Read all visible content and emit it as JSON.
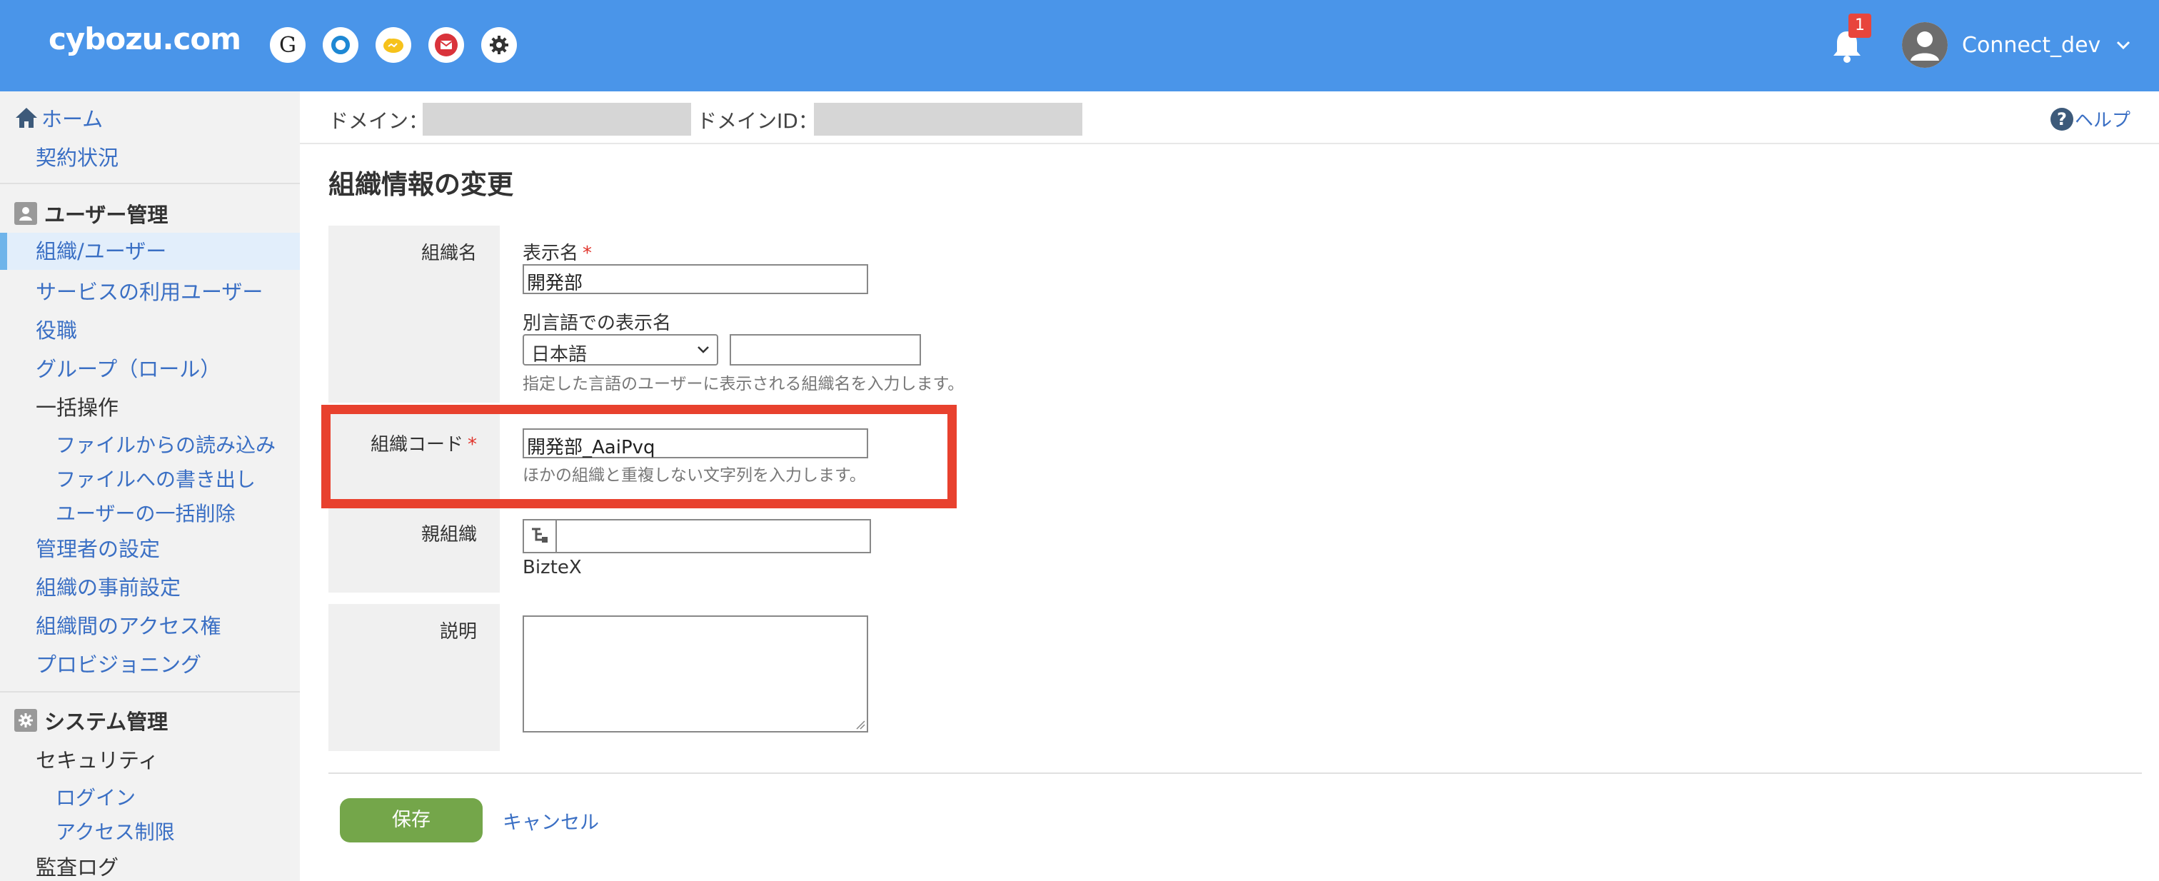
{
  "header": {
    "logo": "cybozu.com",
    "apps": [
      {
        "icon": "g-logo-icon",
        "glyph": "G"
      },
      {
        "icon": "garoon-ring-icon"
      },
      {
        "icon": "kintone-cloud-icon"
      },
      {
        "icon": "mail-icon"
      },
      {
        "icon": "gear-icon"
      }
    ],
    "notification_count": "1",
    "username": "Connect_dev"
  },
  "sidebar": {
    "home": "ホーム",
    "contract": "契約状況",
    "user_admin_heading": "ユーザー管理",
    "org_users": "組織/ユーザー",
    "service_users": "サービスの利用ユーザー",
    "roles": "役職",
    "groups": "グループ（ロール）",
    "bulk": "一括操作",
    "import_file": "ファイルからの読み込み",
    "export_file": "ファイルへの書き出し",
    "bulk_delete": "ユーザーの一括削除",
    "admin_settings": "管理者の設定",
    "org_presets": "組織の事前設定",
    "inter_org_access": "組織間のアクセス権",
    "provisioning": "プロビジョニング",
    "system_admin_heading": "システム管理",
    "security": "セキュリティ",
    "login": "ログイン",
    "access_restriction": "アクセス制限",
    "audit_log": "監査ログ"
  },
  "domainbar": {
    "domain_label": "ドメイン：",
    "domain_id_label": "ドメインID：",
    "help": "ヘルプ"
  },
  "form": {
    "page_title": "組織情報の変更",
    "org_name_label": "組織名",
    "display_name_label": "表示名",
    "display_name_value": "開発部",
    "alt_lang_label": "別言語での表示名",
    "alt_lang_select": "日本語",
    "alt_lang_value": "",
    "alt_lang_hint": "指定した言語のユーザーに表示される組織名を入力します。",
    "org_code_label": "組織コード",
    "org_code_value": "開発部_AaiPvq",
    "org_code_hint": "ほかの組織と重複しない文字列を入力します。",
    "parent_org_label": "親組織",
    "parent_org_value": "",
    "parent_org_name": "BizteX",
    "description_label": "説明",
    "required_mark": "*",
    "save": "保存",
    "cancel": "キャンセル"
  },
  "colors": {
    "header_bg": "#4a95e9",
    "highlight": "#e8412e",
    "save_button": "#74a64a",
    "link": "#3a6fc4"
  }
}
